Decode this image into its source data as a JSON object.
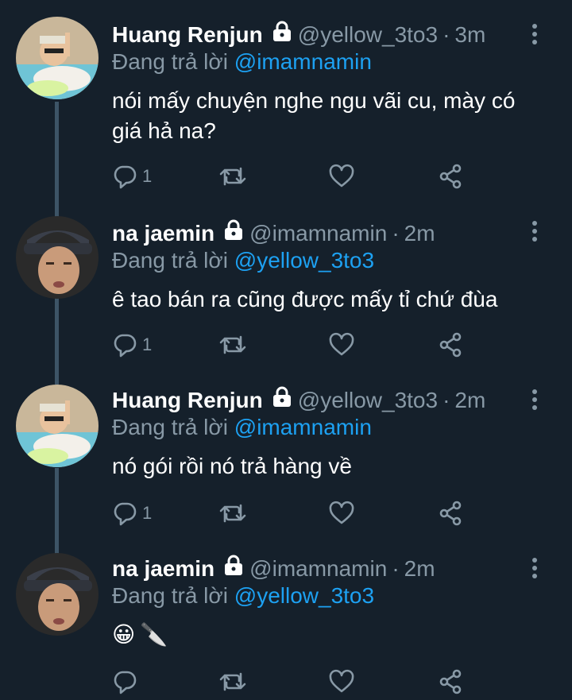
{
  "tweets": [
    {
      "name": "Huang Renjun",
      "handle": "@yellow_3to3",
      "separator": "·",
      "time": "3m",
      "reply_prefix": "Đang trả lời",
      "reply_to": "@imamnamin",
      "text": "nói mấy chuyện nghe ngu vãi cu, mày có giá hả na?",
      "reply_count": "1"
    },
    {
      "name": "na jaemin",
      "handle": "@imamnamin",
      "separator": "·",
      "time": "2m",
      "reply_prefix": "Đang trả lời",
      "reply_to": "@yellow_3to3",
      "text": "ê tao bán ra cũng được mấy tỉ chứ đùa",
      "reply_count": "1"
    },
    {
      "name": "Huang Renjun",
      "handle": "@yellow_3to3",
      "separator": "·",
      "time": "2m",
      "reply_prefix": "Đang trả lời",
      "reply_to": "@imamnamin",
      "text": "nó gói rồi nó trả hàng về",
      "reply_count": "1"
    },
    {
      "name": "na jaemin",
      "handle": "@imamnamin",
      "separator": "·",
      "time": "2m",
      "reply_prefix": "Đang trả lời",
      "reply_to": "@yellow_3to3",
      "text": "",
      "emoji": [
        "😀",
        "🔪"
      ],
      "reply_count": ""
    }
  ],
  "colors": {
    "background": "#15202b",
    "secondary_text": "#8899a6",
    "link": "#1da1f2",
    "thread_line": "#3d5466"
  },
  "icons": [
    "lock-icon",
    "more-icon",
    "reply-icon",
    "retweet-icon",
    "like-icon",
    "share-icon"
  ]
}
